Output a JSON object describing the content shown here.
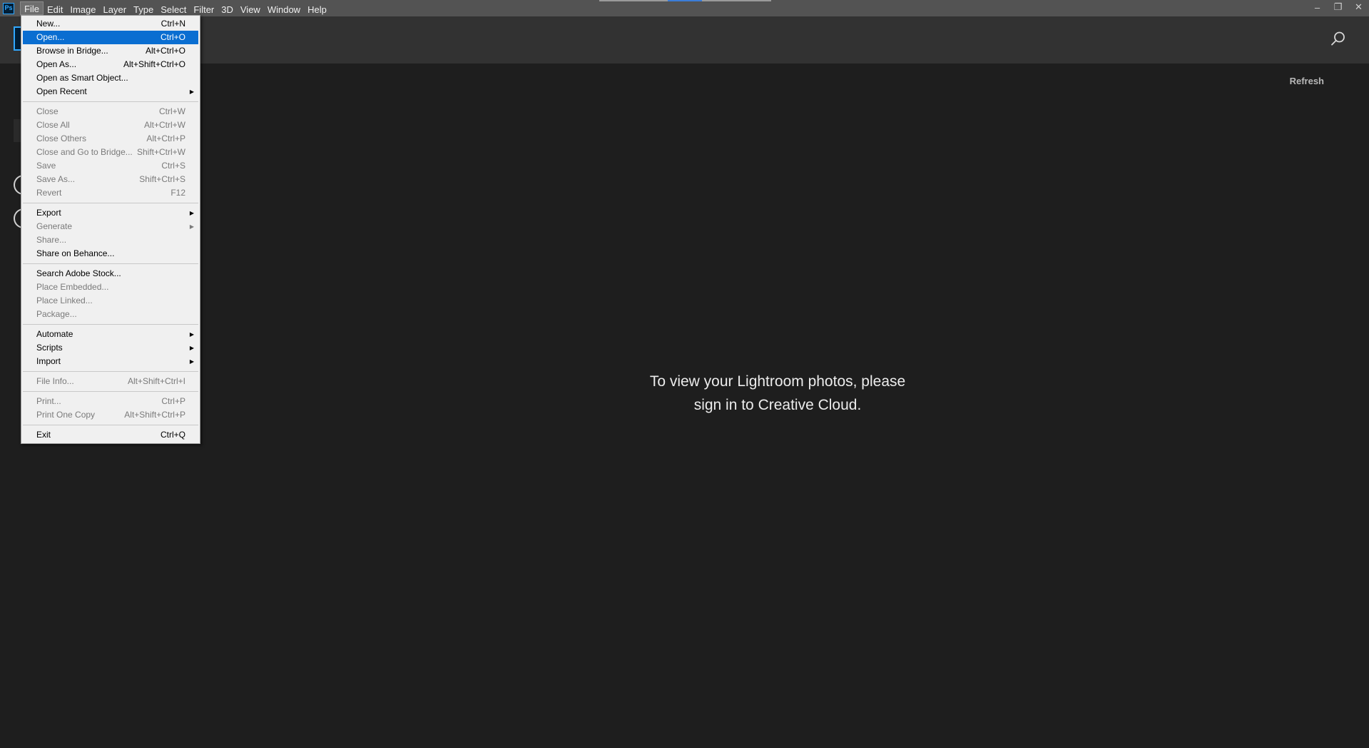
{
  "app": {
    "logo_text": "Ps"
  },
  "menubar": {
    "items": [
      "File",
      "Edit",
      "Image",
      "Layer",
      "Type",
      "Select",
      "Filter",
      "3D",
      "View",
      "Window",
      "Help"
    ]
  },
  "window_controls": {
    "minimize": "–",
    "restore": "❐",
    "close": "✕"
  },
  "home": {
    "refresh_label": "Refresh",
    "message_line1": "To view your Lightroom photos, please",
    "message_line2": "sign in to Creative Cloud."
  },
  "file_menu": {
    "items": [
      {
        "label": "New...",
        "shortcut": "Ctrl+N"
      },
      {
        "label": "Open...",
        "shortcut": "Ctrl+O"
      },
      {
        "label": "Browse in Bridge...",
        "shortcut": "Alt+Ctrl+O"
      },
      {
        "label": "Open As...",
        "shortcut": "Alt+Shift+Ctrl+O"
      },
      {
        "label": "Open as Smart Object...",
        "shortcut": ""
      },
      {
        "label": "Open Recent",
        "shortcut": ""
      },
      {
        "label": "Close",
        "shortcut": "Ctrl+W"
      },
      {
        "label": "Close All",
        "shortcut": "Alt+Ctrl+W"
      },
      {
        "label": "Close Others",
        "shortcut": "Alt+Ctrl+P"
      },
      {
        "label": "Close and Go to Bridge...",
        "shortcut": "Shift+Ctrl+W"
      },
      {
        "label": "Save",
        "shortcut": "Ctrl+S"
      },
      {
        "label": "Save As...",
        "shortcut": "Shift+Ctrl+S"
      },
      {
        "label": "Revert",
        "shortcut": "F12"
      },
      {
        "label": "Export",
        "shortcut": ""
      },
      {
        "label": "Generate",
        "shortcut": ""
      },
      {
        "label": "Share...",
        "shortcut": ""
      },
      {
        "label": "Share on Behance...",
        "shortcut": ""
      },
      {
        "label": "Search Adobe Stock...",
        "shortcut": ""
      },
      {
        "label": "Place Embedded...",
        "shortcut": ""
      },
      {
        "label": "Place Linked...",
        "shortcut": ""
      },
      {
        "label": "Package...",
        "shortcut": ""
      },
      {
        "label": "Automate",
        "shortcut": ""
      },
      {
        "label": "Scripts",
        "shortcut": ""
      },
      {
        "label": "Import",
        "shortcut": ""
      },
      {
        "label": "File Info...",
        "shortcut": "Alt+Shift+Ctrl+I"
      },
      {
        "label": "Print...",
        "shortcut": "Ctrl+P"
      },
      {
        "label": "Print One Copy",
        "shortcut": "Alt+Shift+Ctrl+P"
      },
      {
        "label": "Exit",
        "shortcut": "Ctrl+Q"
      }
    ]
  },
  "colors": {
    "menubar_bg": "#535353",
    "header_bg": "#323232",
    "body_bg": "#1e1e1e",
    "menu_bg": "#f0f0f0",
    "highlight": "#0a6ed1",
    "ps_blue": "#31a8ff"
  }
}
